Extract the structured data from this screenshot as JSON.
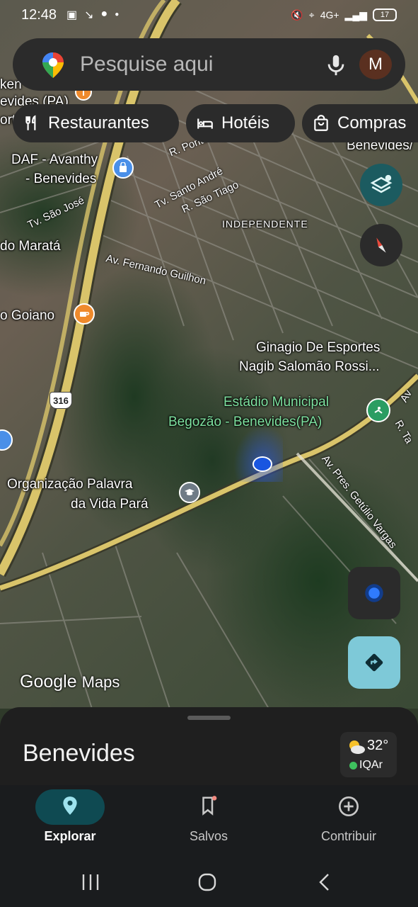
{
  "status_bar": {
    "time": "12:48",
    "network": "4G+",
    "battery": "17"
  },
  "search": {
    "placeholder": "Pesquise aqui",
    "avatar_letter": "M"
  },
  "chips": [
    {
      "label": "Restaurantes",
      "icon": "fork-knife-icon"
    },
    {
      "label": "Hotéis",
      "icon": "bed-icon"
    },
    {
      "label": "Compras",
      "icon": "shopping-bag-icon"
    }
  ],
  "map": {
    "labels": {
      "ken_partial": "ken",
      "evides_partial": "evides (PA)",
      "ort_partial": "ort",
      "benevides_top": "Benevides/",
      "daf_line1": "DAF - Avanthy",
      "daf_line2": "- Benevides",
      "do_marata": "do Maratá",
      "goiano": "o Goiano",
      "independente": "INDEPENDENTE",
      "ginagio_line1": "Ginagio De Esportes",
      "ginagio_line2": "Nagib Salomão Rossi...",
      "estadio_line1": "Estádio Municipal",
      "estadio_line2": "Begozão - Benevides(PA)",
      "organizacao_line1": "Organização Palavra",
      "organizacao_line2": "da Vida Pará"
    },
    "roads": {
      "ponta": "R. Ponta-Po",
      "santo_andre": "Tv. Santo André",
      "sao_tiago": "R. São Tiago",
      "sao_jose": "Tv. São José",
      "fernando": "Av. Fernando Guilhon",
      "getulio": "Av. Pres. Getúlio Vargas",
      "av_partial": "Av",
      "r_ta": "R. Ta"
    },
    "highway_number": "316",
    "watermark_google": "Google",
    "watermark_maps": "Maps"
  },
  "sheet": {
    "title": "Benevides",
    "temperature": "32°",
    "air_quality": "IQAr"
  },
  "bottom_nav": [
    {
      "label": "Explorar",
      "icon": "location-pin-icon",
      "active": true
    },
    {
      "label": "Salvos",
      "icon": "bookmark-icon",
      "active": false
    },
    {
      "label": "Contribuir",
      "icon": "add-circle-icon",
      "active": false
    }
  ],
  "colors": {
    "accent_teal": "#7ec9d8",
    "active_pill": "#0f4a52",
    "road_yellow": "#d9c46a",
    "location_blue": "#1a56e0"
  }
}
